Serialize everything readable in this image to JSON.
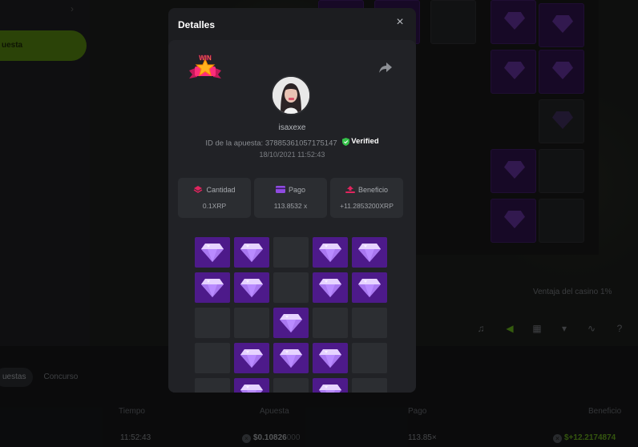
{
  "background": {
    "bet_button_label": "uesta",
    "house_edge": "Ventaja del casino 1%",
    "tabs": [
      {
        "label": "uestas",
        "active": true
      },
      {
        "label": "Concurso",
        "active": false
      }
    ],
    "table": {
      "headers": {
        "time": "Tiempo",
        "bet": "Apuesta",
        "payout": "Pago",
        "profit": "Beneficio"
      },
      "row": {
        "time": "11:52:43",
        "bet_strong": "$0.10826",
        "bet_faded": "000",
        "payout": "113.85×",
        "profit": "$+12.2174874"
      }
    },
    "accent_color": "#5fa61a"
  },
  "modal": {
    "title": "Detalles",
    "username": "isaxexe",
    "bet_id_label": "ID de la apuesta:",
    "bet_id": "378853610571751​47",
    "verified_label": "Verified",
    "date": "18/10/2021 11:52:43",
    "badge_text": "WIN",
    "stats": [
      {
        "label": "Cantidad",
        "value": "0.1XRP",
        "icon": "stack-icon",
        "icon_color": "#e0245e"
      },
      {
        "label": "Pago",
        "value": "113.8532 x",
        "icon": "card-icon",
        "icon_color": "#8f4be0"
      },
      {
        "label": "Beneficio",
        "value": "+11.2853200XRP",
        "icon": "profit-icon",
        "icon_color": "#e0245e"
      }
    ],
    "grid": [
      [
        1,
        1,
        0,
        1,
        1
      ],
      [
        1,
        1,
        0,
        1,
        1
      ],
      [
        0,
        0,
        1,
        0,
        0
      ],
      [
        0,
        1,
        1,
        1,
        0
      ],
      [
        0,
        1,
        0,
        1,
        0
      ]
    ],
    "gem_color": "#4d1a8a"
  }
}
